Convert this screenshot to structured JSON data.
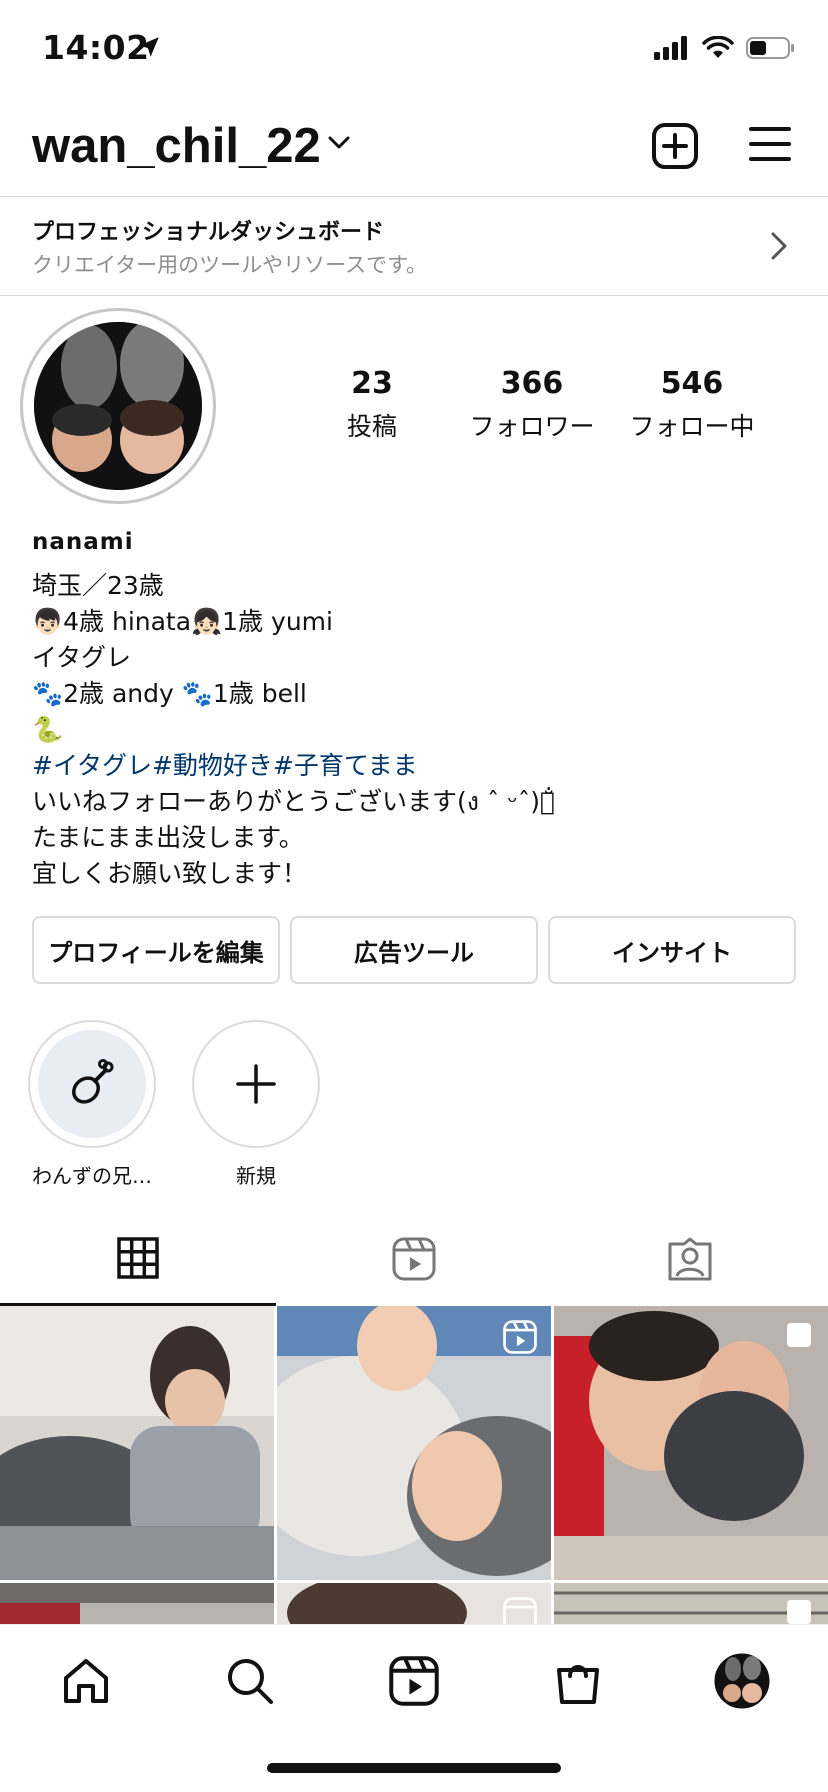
{
  "status_bar": {
    "time": "14:02"
  },
  "header": {
    "username": "wan_chil_22"
  },
  "dashboard": {
    "title": "プロフェッショナルダッシュボード",
    "subtitle": "クリエイター用のツールやリソースです。"
  },
  "stats": [
    {
      "value": "23",
      "label": "投稿"
    },
    {
      "value": "366",
      "label": "フォロワー"
    },
    {
      "value": "546",
      "label": "フォロー中"
    }
  ],
  "bio": {
    "name": "nanami",
    "lines": [
      "埼玉／23歳",
      "👦🏻4歳 hinata👧🏻1歳 yumi",
      "イタグレ",
      "🐾2歳 andy  🐾1歳 bell",
      "🐍",
      "#イタグレ#動物好き#子育てまま",
      "いいねフォローありがとうございます(ง ˆ ᵕˆ)ว̐",
      "たまにまま出没します。",
      "宜しくお願い致します！"
    ]
  },
  "buttons": {
    "edit_profile": "プロフィールを編集",
    "ad_tools": "広告ツール",
    "insights": "インサイト"
  },
  "highlights": [
    {
      "label": "わんずの兄…"
    },
    {
      "label": "新規"
    }
  ],
  "tabs": [
    "grid-icon",
    "reels-icon",
    "tagged-icon"
  ],
  "nav": [
    "home-icon",
    "search-icon",
    "reels-icon",
    "shop-icon",
    "profile-avatar"
  ],
  "colors": {
    "hashtag": "#00376b",
    "border": "#dbdbdb",
    "muted": "#8e8e8e"
  }
}
